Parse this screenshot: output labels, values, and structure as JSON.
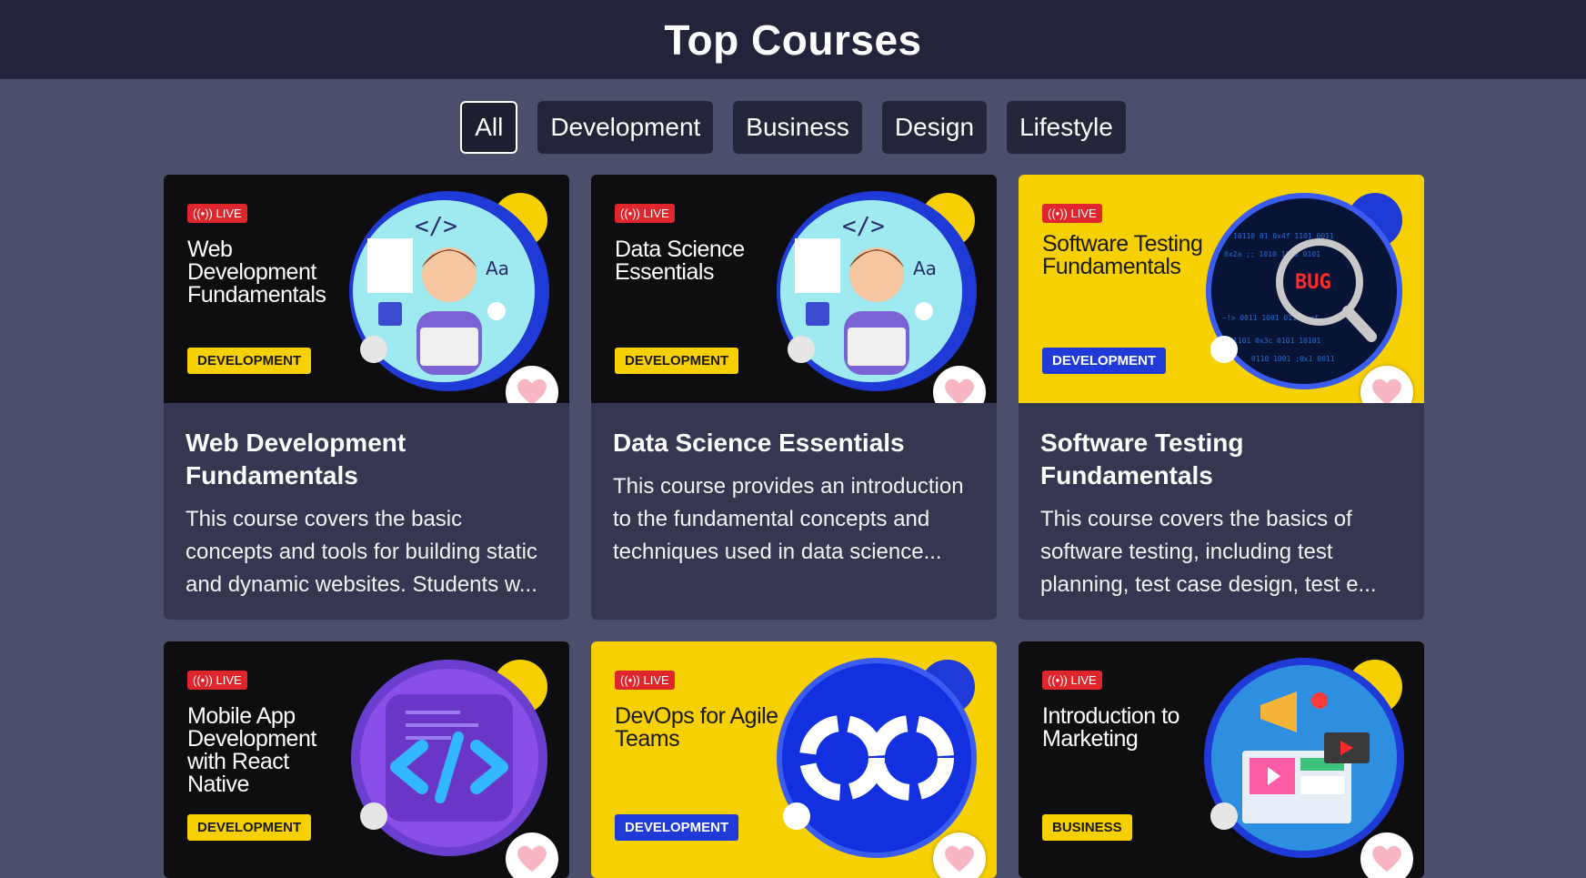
{
  "header": {
    "title": "Top Courses"
  },
  "filters": [
    {
      "label": "All",
      "active": true
    },
    {
      "label": "Development",
      "active": false
    },
    {
      "label": "Business",
      "active": false
    },
    {
      "label": "Design",
      "active": false
    },
    {
      "label": "Lifestyle",
      "active": false
    }
  ],
  "courses": [
    {
      "live_label": "LIVE",
      "thumb_title": "Web Development Fundamentals",
      "category": "DEVELOPMENT",
      "title": "Web Development Fundamentals",
      "description": "This course covers the basic concepts and tools for building static and dynamic websites. Students w...",
      "thumb_style": "dark",
      "art": "developer-laptop-icon"
    },
    {
      "live_label": "LIVE",
      "thumb_title": "Data Science Essentials",
      "category": "DEVELOPMENT",
      "title": "Data Science Essentials",
      "description": "This course provides an introduction to the fundamental concepts and techniques used in data science...",
      "thumb_style": "dark",
      "art": "developer-laptop-icon"
    },
    {
      "live_label": "LIVE",
      "thumb_title": "Software Testing Fundamentals",
      "category": "DEVELOPMENT",
      "title": "Software Testing Fundamentals",
      "description": "This course covers the basics of software testing, including test planning, test case design, test e...",
      "thumb_style": "yellow",
      "art": "bug-magnifier-icon",
      "art_text": "BUG"
    },
    {
      "live_label": "LIVE",
      "thumb_title": "Mobile App Development with React Native",
      "category": "DEVELOPMENT",
      "title": "",
      "description": "",
      "thumb_style": "dark",
      "art": "code-brackets-icon"
    },
    {
      "live_label": "LIVE",
      "thumb_title": "DevOps for Agile Teams",
      "category": "DEVELOPMENT",
      "title": "",
      "description": "",
      "thumb_style": "yellow",
      "art": "infinity-loop-icon"
    },
    {
      "live_label": "LIVE",
      "thumb_title": "Introduction to Marketing",
      "category": "BUSINESS",
      "title": "",
      "description": "",
      "thumb_style": "dark",
      "art": "marketing-megaphone-icon"
    }
  ],
  "colors": {
    "page_bg": "#4c4f6b",
    "header_bg": "#23233c",
    "card_bg": "#353750",
    "accent_yellow": "#f6d000",
    "accent_blue": "#1f3ad6",
    "live_red": "#e0262d",
    "heart_pink": "#f7b6c2"
  }
}
